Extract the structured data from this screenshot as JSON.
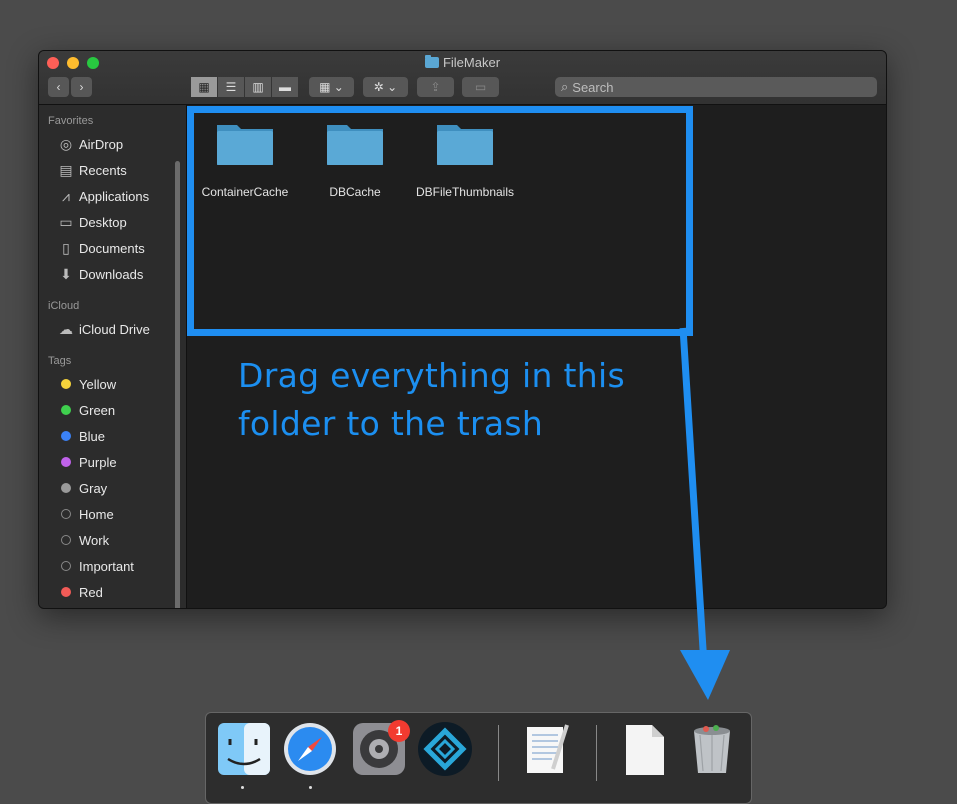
{
  "window": {
    "title": "FileMaker"
  },
  "toolbar": {
    "back": "‹",
    "forward": "›",
    "search_placeholder": "Search"
  },
  "sidebar": {
    "favorites_header": "Favorites",
    "favorites": [
      {
        "label": "AirDrop",
        "icon": "airdrop-icon"
      },
      {
        "label": "Recents",
        "icon": "recents-icon"
      },
      {
        "label": "Applications",
        "icon": "applications-icon"
      },
      {
        "label": "Desktop",
        "icon": "desktop-icon"
      },
      {
        "label": "Documents",
        "icon": "documents-icon"
      },
      {
        "label": "Downloads",
        "icon": "downloads-icon"
      }
    ],
    "icloud_header": "iCloud",
    "icloud": [
      {
        "label": "iCloud Drive",
        "icon": "cloud-icon"
      }
    ],
    "tags_header": "Tags",
    "tags": [
      {
        "label": "Yellow",
        "color": "#f5d33b"
      },
      {
        "label": "Green",
        "color": "#3fd04e"
      },
      {
        "label": "Blue",
        "color": "#3b82f6"
      },
      {
        "label": "Purple",
        "color": "#c062ea"
      },
      {
        "label": "Gray",
        "color": "#9a9a9a"
      },
      {
        "label": "Home",
        "color": ""
      },
      {
        "label": "Work",
        "color": ""
      },
      {
        "label": "Important",
        "color": ""
      },
      {
        "label": "Red",
        "color": "#f25b57"
      }
    ]
  },
  "files": [
    {
      "name": "ContainerCache"
    },
    {
      "name": "DBCache"
    },
    {
      "name": "DBFileThumbnails"
    }
  ],
  "annotation": {
    "line1": "Drag everything in this",
    "line2": "folder to the trash",
    "color": "#1f8ef1"
  },
  "dock": {
    "badge": "1",
    "apps": [
      "finder-icon",
      "safari-icon",
      "system-preferences-icon",
      "filemaker-icon",
      "textedit-icon",
      "document-icon",
      "trash-icon"
    ]
  }
}
